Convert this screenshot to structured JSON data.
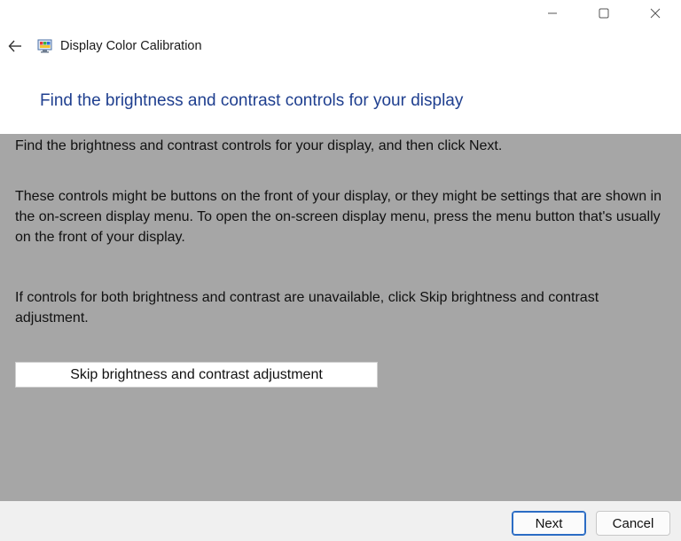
{
  "window": {
    "controls": {
      "minimize_icon": "minimize-icon",
      "maximize_icon": "maximize-icon",
      "close_icon": "close-icon"
    }
  },
  "titlebar": {
    "back_icon": "back-arrow-icon",
    "app_icon": "display-calibration-icon",
    "title": "Display Color Calibration"
  },
  "header": {
    "heading": "Find the brightness and contrast controls for your display"
  },
  "content": {
    "paragraph1": "Find the brightness and contrast controls for your display, and then click Next.",
    "paragraph2": "These controls might be buttons on the front of your display, or they might be settings that are shown in the on-screen display menu. To open the on-screen display menu, press the menu button that's usually on the front of your display.",
    "paragraph3": "If controls for both brightness and contrast are unavailable, click Skip brightness and contrast adjustment.",
    "skip_button": "Skip brightness and contrast adjustment"
  },
  "footer": {
    "next_label": "Next",
    "cancel_label": "Cancel"
  },
  "colors": {
    "heading": "#1f3f8f",
    "content_background": "#a6a6a6",
    "footer_background": "#f0f0f0",
    "accent": "#2b6cc4"
  }
}
